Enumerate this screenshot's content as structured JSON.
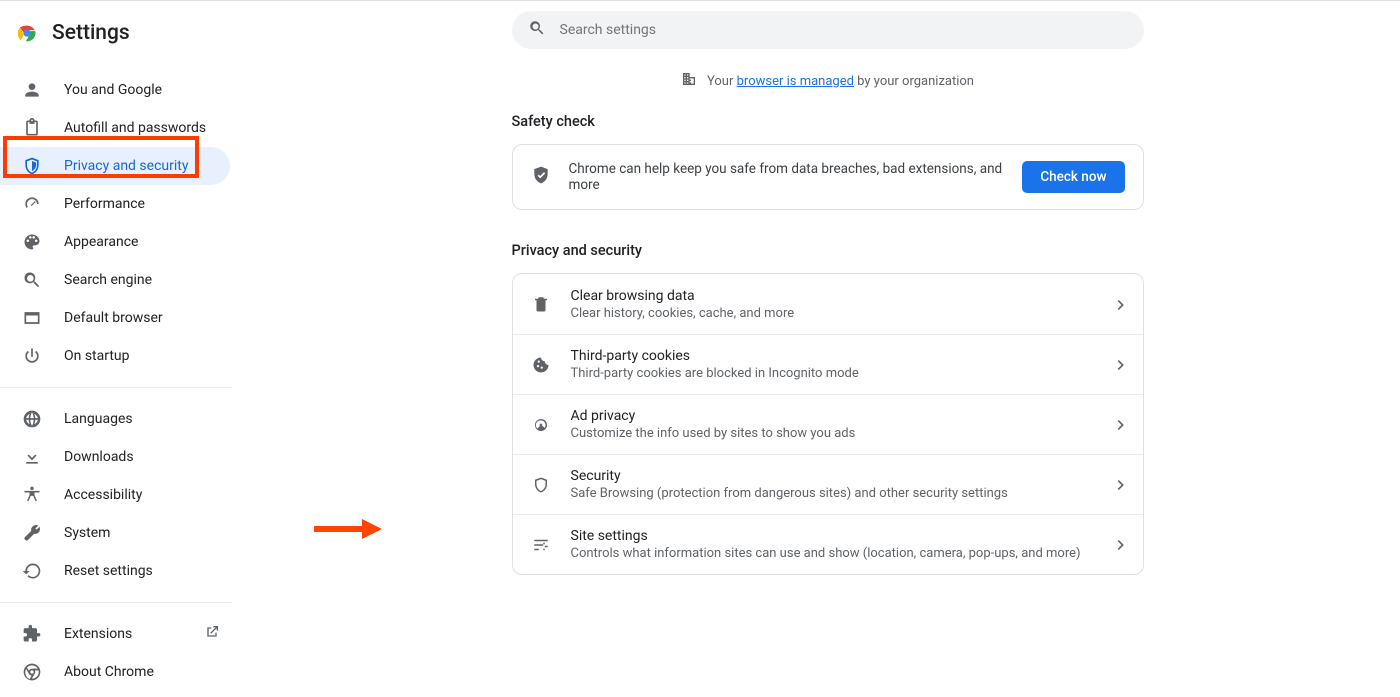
{
  "header": {
    "title": "Settings"
  },
  "search": {
    "placeholder": "Search settings"
  },
  "managed_banner": {
    "prefix": "Your ",
    "link": "browser is managed",
    "suffix": " by your organization"
  },
  "sidebar": {
    "items": [
      {
        "label": "You and Google",
        "icon": "person"
      },
      {
        "label": "Autofill and passwords",
        "icon": "clipboard"
      },
      {
        "label": "Privacy and security",
        "icon": "shield",
        "active": true
      },
      {
        "label": "Performance",
        "icon": "speedometer"
      },
      {
        "label": "Appearance",
        "icon": "palette"
      },
      {
        "label": "Search engine",
        "icon": "search"
      },
      {
        "label": "Default browser",
        "icon": "browser-window"
      },
      {
        "label": "On startup",
        "icon": "power"
      }
    ],
    "items2": [
      {
        "label": "Languages",
        "icon": "globe"
      },
      {
        "label": "Downloads",
        "icon": "download"
      },
      {
        "label": "Accessibility",
        "icon": "accessibility"
      },
      {
        "label": "System",
        "icon": "wrench"
      },
      {
        "label": "Reset settings",
        "icon": "restore"
      }
    ],
    "items3": [
      {
        "label": "Extensions",
        "icon": "puzzle",
        "external": true
      },
      {
        "label": "About Chrome",
        "icon": "chrome-outline"
      }
    ]
  },
  "safety_check": {
    "section_title": "Safety check",
    "text": "Chrome can help keep you safe from data breaches, bad extensions, and more",
    "button": "Check now"
  },
  "privacy_section": {
    "title": "Privacy and security",
    "rows": [
      {
        "title": "Clear browsing data",
        "sub": "Clear history, cookies, cache, and more",
        "icon": "trash"
      },
      {
        "title": "Third-party cookies",
        "sub": "Third-party cookies are blocked in Incognito mode",
        "icon": "cookie"
      },
      {
        "title": "Ad privacy",
        "sub": "Customize the info used by sites to show you ads",
        "icon": "ad-target"
      },
      {
        "title": "Security",
        "sub": "Safe Browsing (protection from dangerous sites) and other security settings",
        "icon": "shield-outline"
      },
      {
        "title": "Site settings",
        "sub": "Controls what information sites can use and show (location, camera, pop-ups, and more)",
        "icon": "tune"
      }
    ]
  }
}
